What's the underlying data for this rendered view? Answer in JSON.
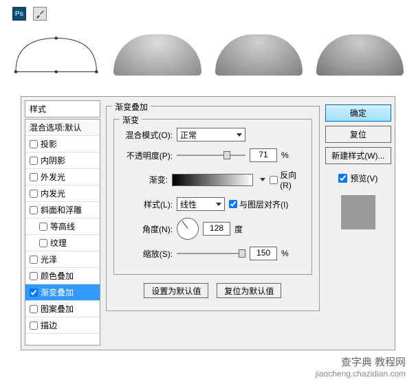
{
  "topIcons": {
    "ps": "Ps"
  },
  "styles": {
    "header": "样式",
    "default": "混合选项:默认",
    "items": [
      "投影",
      "内阴影",
      "外发光",
      "内发光",
      "斜面和浮雕",
      "等高线",
      "纹理",
      "光泽",
      "颜色叠加",
      "渐变叠加",
      "图案叠加",
      "描边"
    ]
  },
  "gradient": {
    "title": "渐变叠加",
    "fieldset": "渐变",
    "blendMode": {
      "label": "混合模式(O):",
      "value": "正常"
    },
    "opacity": {
      "label": "不透明度(P):",
      "value": "71",
      "suffix": "%"
    },
    "gradientRow": {
      "label": "渐变:",
      "reverse": "反向(R)"
    },
    "style": {
      "label": "样式(L):",
      "value": "线性",
      "align": "与图层对齐(I)"
    },
    "angle": {
      "label": "角度(N):",
      "value": "128",
      "suffix": "度"
    },
    "scale": {
      "label": "缩放(S):",
      "value": "150",
      "suffix": "%"
    },
    "setDefault": "设置为默认值",
    "resetDefault": "复位为默认值"
  },
  "buttons": {
    "ok": "确定",
    "reset": "复位",
    "newStyle": "新建样式(W)...",
    "preview": "预览(V)"
  },
  "watermark": {
    "main": "查字典 教程网",
    "sub": "jiaocheng.chazidian.com"
  }
}
